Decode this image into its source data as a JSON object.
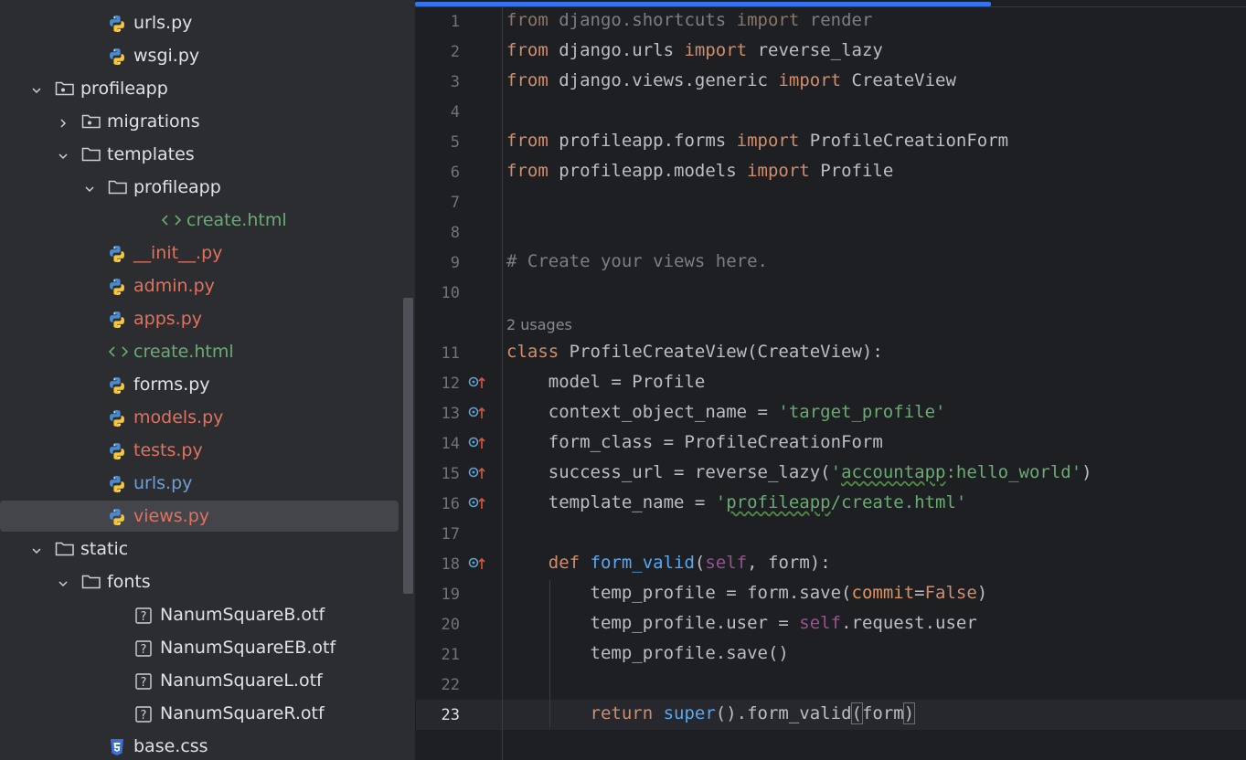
{
  "project_tree": {
    "items": [
      {
        "label": "urls.py",
        "type": "py",
        "color": "c-def",
        "level": 3,
        "chevron": "none"
      },
      {
        "label": "wsgi.py",
        "type": "py",
        "color": "c-def",
        "level": 3,
        "chevron": "none"
      },
      {
        "label": "profileapp",
        "type": "pkg",
        "color": "c-def",
        "level": 1,
        "chevron": "down"
      },
      {
        "label": "migrations",
        "type": "pkg",
        "color": "c-def",
        "level": 2,
        "chevron": "right"
      },
      {
        "label": "templates",
        "type": "folder",
        "color": "c-def",
        "level": 2,
        "chevron": "down"
      },
      {
        "label": "profileapp",
        "type": "folder",
        "color": "c-def",
        "level": 3,
        "chevron": "down"
      },
      {
        "label": "create.html",
        "type": "html",
        "color": "c-green",
        "level": 5,
        "chevron": "none"
      },
      {
        "label": "__init__.py",
        "type": "py",
        "color": "c-red",
        "level": 3,
        "chevron": "none"
      },
      {
        "label": "admin.py",
        "type": "py",
        "color": "c-red",
        "level": 3,
        "chevron": "none"
      },
      {
        "label": "apps.py",
        "type": "py",
        "color": "c-red",
        "level": 3,
        "chevron": "none"
      },
      {
        "label": "create.html",
        "type": "html",
        "color": "c-green",
        "level": 3,
        "chevron": "none"
      },
      {
        "label": "forms.py",
        "type": "py",
        "color": "c-def",
        "level": 3,
        "chevron": "none"
      },
      {
        "label": "models.py",
        "type": "py",
        "color": "c-red",
        "level": 3,
        "chevron": "none"
      },
      {
        "label": "tests.py",
        "type": "py",
        "color": "c-red",
        "level": 3,
        "chevron": "none"
      },
      {
        "label": "urls.py",
        "type": "py",
        "color": "c-blue",
        "level": 3,
        "chevron": "none"
      },
      {
        "label": "views.py",
        "type": "py",
        "color": "c-red",
        "level": 3,
        "chevron": "none",
        "selected": true
      },
      {
        "label": "static",
        "type": "folder",
        "color": "c-def",
        "level": 1,
        "chevron": "down"
      },
      {
        "label": "fonts",
        "type": "folder",
        "color": "c-def",
        "level": 2,
        "chevron": "down"
      },
      {
        "label": "NanumSquareB.otf",
        "type": "unknown",
        "color": "c-def",
        "level": 4,
        "chevron": "none"
      },
      {
        "label": "NanumSquareEB.otf",
        "type": "unknown",
        "color": "c-def",
        "level": 4,
        "chevron": "none"
      },
      {
        "label": "NanumSquareL.otf",
        "type": "unknown",
        "color": "c-def",
        "level": 4,
        "chevron": "none"
      },
      {
        "label": "NanumSquareR.otf",
        "type": "unknown",
        "color": "c-def",
        "level": 4,
        "chevron": "none"
      },
      {
        "label": "base.css",
        "type": "css",
        "color": "c-def",
        "level": 3,
        "chevron": "none"
      }
    ]
  },
  "editor": {
    "file": "views.py",
    "usages_hint": "2 usages",
    "current_line": 23,
    "lines": [
      {
        "n": "1",
        "tokens": [
          [
            "dim-kw",
            "from"
          ],
          [
            "cmt",
            " django.shortcuts "
          ],
          [
            "dim-kw",
            "import"
          ],
          [
            "cmt",
            " render"
          ]
        ]
      },
      {
        "n": "2",
        "tokens": [
          [
            "kw",
            "from"
          ],
          [
            "",
            " django.urls "
          ],
          [
            "kw",
            "import"
          ],
          [
            "",
            " reverse_lazy"
          ]
        ]
      },
      {
        "n": "3",
        "tokens": [
          [
            "kw",
            "from"
          ],
          [
            "",
            " django.views.generic "
          ],
          [
            "kw",
            "import"
          ],
          [
            "",
            " CreateView"
          ]
        ]
      },
      {
        "n": "4",
        "tokens": []
      },
      {
        "n": "5",
        "tokens": [
          [
            "kw",
            "from"
          ],
          [
            "",
            " profileapp.forms "
          ],
          [
            "kw",
            "import"
          ],
          [
            "",
            " ProfileCreationForm"
          ]
        ]
      },
      {
        "n": "6",
        "tokens": [
          [
            "kw",
            "from"
          ],
          [
            "",
            " profileapp.models "
          ],
          [
            "kw",
            "import"
          ],
          [
            "",
            " Profile"
          ]
        ]
      },
      {
        "n": "7",
        "tokens": []
      },
      {
        "n": "8",
        "tokens": []
      },
      {
        "n": "9",
        "tokens": [
          [
            "cmt",
            "# Create your views here."
          ]
        ]
      },
      {
        "n": "10",
        "tokens": []
      },
      {
        "n": "11",
        "tokens": [
          [
            "kw",
            "class"
          ],
          [
            "",
            " ProfileCreateView(CreateView):"
          ]
        ]
      },
      {
        "n": "12",
        "tokens": [
          [
            "",
            "    model = Profile"
          ]
        ]
      },
      {
        "n": "13",
        "tokens": [
          [
            "",
            "    context_object_name = "
          ],
          [
            "str",
            "'target_profile'"
          ]
        ]
      },
      {
        "n": "14",
        "tokens": [
          [
            "",
            "    form_class = ProfileCreationForm"
          ]
        ]
      },
      {
        "n": "15",
        "tokens": [
          [
            "",
            "    success_url = reverse_lazy("
          ],
          [
            "str",
            "'"
          ],
          [
            "str wavy",
            "accountapp"
          ],
          [
            "str",
            ":hello_world'"
          ],
          [
            "",
            ")"
          ]
        ]
      },
      {
        "n": "16",
        "tokens": [
          [
            "",
            "    template_name = "
          ],
          [
            "str",
            "'"
          ],
          [
            "str wavy",
            "profileapp"
          ],
          [
            "str",
            "/create.html'"
          ]
        ]
      },
      {
        "n": "17",
        "tokens": []
      },
      {
        "n": "18",
        "tokens": [
          [
            "kw",
            "    def "
          ],
          [
            "fn",
            "form_valid"
          ],
          [
            "",
            "("
          ],
          [
            "slf",
            "self"
          ],
          [
            "",
            ", form):"
          ]
        ]
      },
      {
        "n": "19",
        "tokens": [
          [
            "",
            "        temp_profile = form.save("
          ],
          [
            "prm",
            "commit"
          ],
          [
            "",
            "="
          ],
          [
            "kw",
            "False"
          ],
          [
            "",
            ")"
          ]
        ]
      },
      {
        "n": "20",
        "tokens": [
          [
            "",
            "        temp_profile.user = "
          ],
          [
            "slf",
            "self"
          ],
          [
            "",
            ".request.user"
          ]
        ]
      },
      {
        "n": "21",
        "tokens": [
          [
            "",
            "        temp_profile.save()"
          ]
        ]
      },
      {
        "n": "22",
        "tokens": []
      },
      {
        "n": "23",
        "tokens": [
          [
            "kw",
            "        return "
          ],
          [
            "fn",
            "super"
          ],
          [
            "",
            "().form_valid"
          ],
          [
            "bracehl",
            "("
          ],
          [
            "",
            "form"
          ],
          [
            "bracehl",
            ")"
          ]
        ]
      }
    ],
    "override_marker_lines": [
      "12",
      "13",
      "14",
      "15",
      "16",
      "18"
    ]
  },
  "colors": {
    "accent": "#3574f0",
    "keyword": "#cf8e6d",
    "string": "#6aab73",
    "function": "#56a8f5",
    "self": "#94558d",
    "param": "#e0935b",
    "comment": "#7a7e85"
  },
  "icons": {
    "py": "python-file-icon",
    "pkg": "package-folder-icon",
    "folder": "folder-icon",
    "html": "html-file-icon",
    "unknown": "unknown-file-icon",
    "css": "css-file-icon",
    "marker": "override-method-gutter-icon"
  }
}
